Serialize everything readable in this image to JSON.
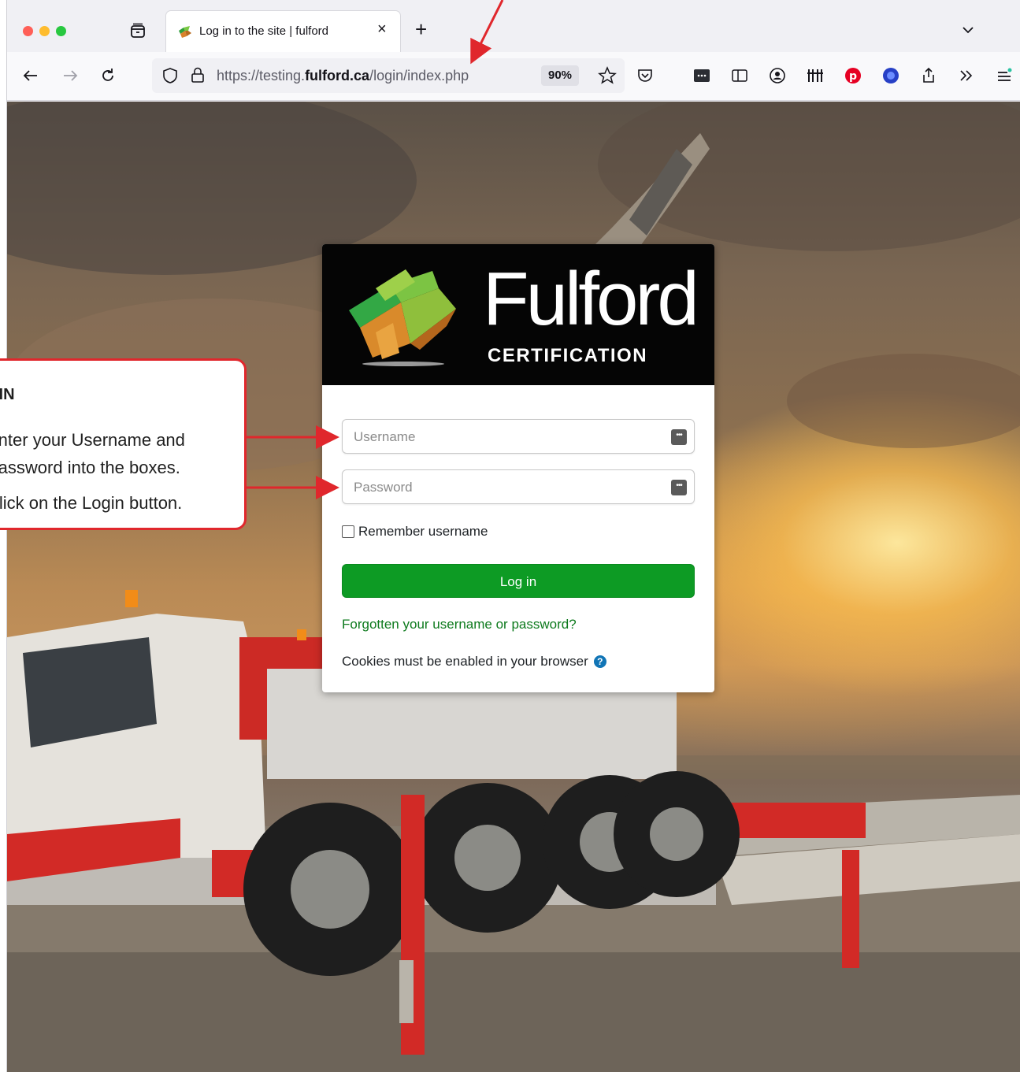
{
  "browser": {
    "tab_title": "Log in to the site | fulford",
    "tab_close": "×",
    "new_tab": "+",
    "url_prefix": "https://testing.",
    "url_domain": "fulford.ca",
    "url_path": "/login/index.php",
    "zoom": "90%"
  },
  "brand": {
    "name": "Fulford",
    "subtitle": "CERTIFICATION"
  },
  "login": {
    "username_placeholder": "Username",
    "password_placeholder": "Password",
    "remember_label": "Remember username",
    "button_label": "Log in",
    "forgot_link": "Forgotten your username or password?",
    "cookies_notice": "Cookies must be enabled in your browser"
  },
  "callout": {
    "title": "GIN",
    "line1": "Enter your Username and",
    "line2": "Password into the boxes.",
    "line3": "Click on the Login button."
  },
  "colors": {
    "login_button": "#0d9b24",
    "link": "#0d7a1d",
    "annotation": "#e0272c"
  }
}
